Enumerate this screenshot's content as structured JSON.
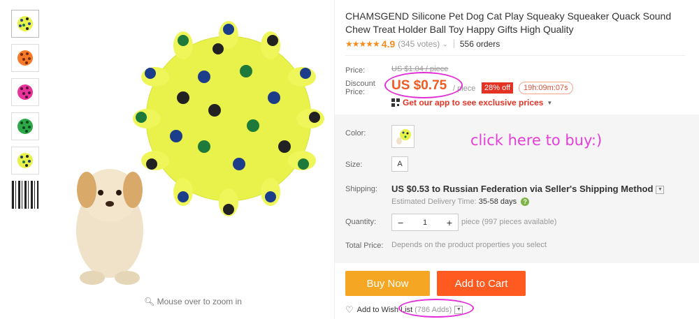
{
  "thumbnails": [
    {
      "name": "yellow-ball",
      "color": "#e7f34a",
      "dot": "#2a3f97"
    },
    {
      "name": "orange-ball",
      "color": "#f57a2a",
      "dot": "#7a2a10"
    },
    {
      "name": "pink-ball",
      "color": "#e7349a",
      "dot": "#5a0f3a"
    },
    {
      "name": "green-ball",
      "color": "#2fa84a",
      "dot": "#0d4a1e"
    },
    {
      "name": "yellow-ball-2",
      "color": "#e8f04b",
      "dot": "#1b3d6a"
    }
  ],
  "zoom_hint": "Mouse over to zoom in",
  "product": {
    "title": "CHAMSGEND Silicone Pet Dog Cat Play Squeaky Squeaker Quack Sound Chew Treat Holder Ball Toy Happy Gifts High Quality",
    "rating": "4.9",
    "votes": "(345 votes)",
    "orders": "556 orders",
    "stars": "★★★★★",
    "rating_value": 4.9
  },
  "price": {
    "price_label": "Price:",
    "old_price": "US $1.04 / piece",
    "discount_label_line1": "Discount",
    "discount_label_line2": "Price:",
    "discount_price": "US $0.75",
    "per": "/ piece",
    "off": "28% off",
    "timer": "19h:09m:07s",
    "app_promo": "Get our app to see exclusive prices"
  },
  "options": {
    "color_label": "Color:",
    "size_label": "Size:",
    "size_value": "A",
    "shipping_label": "Shipping:",
    "shipping_text": "US $0.53 to Russian Federation via Seller's Shipping Method",
    "est_label": "Estimated Delivery Time:",
    "est_value": "35-58 days",
    "quantity_label": "Quantity:",
    "qty_minus": "−",
    "qty_value": "1",
    "qty_plus": "+",
    "qty_avail": "piece (997 pieces available)",
    "total_label": "Total Price:",
    "total_value": "Depends on the product properties you select"
  },
  "annotation": "click here to buy:)",
  "actions": {
    "buy_now": "Buy Now",
    "add_to_cart": "Add to Cart",
    "wishlist": "Add to Wish List",
    "wishlist_adds": "(786 Adds)"
  },
  "colors": {
    "accent": "#f05a23",
    "buy": "#f5a623",
    "cart": "#ff5a1f",
    "annotation": "#e53fd8"
  }
}
